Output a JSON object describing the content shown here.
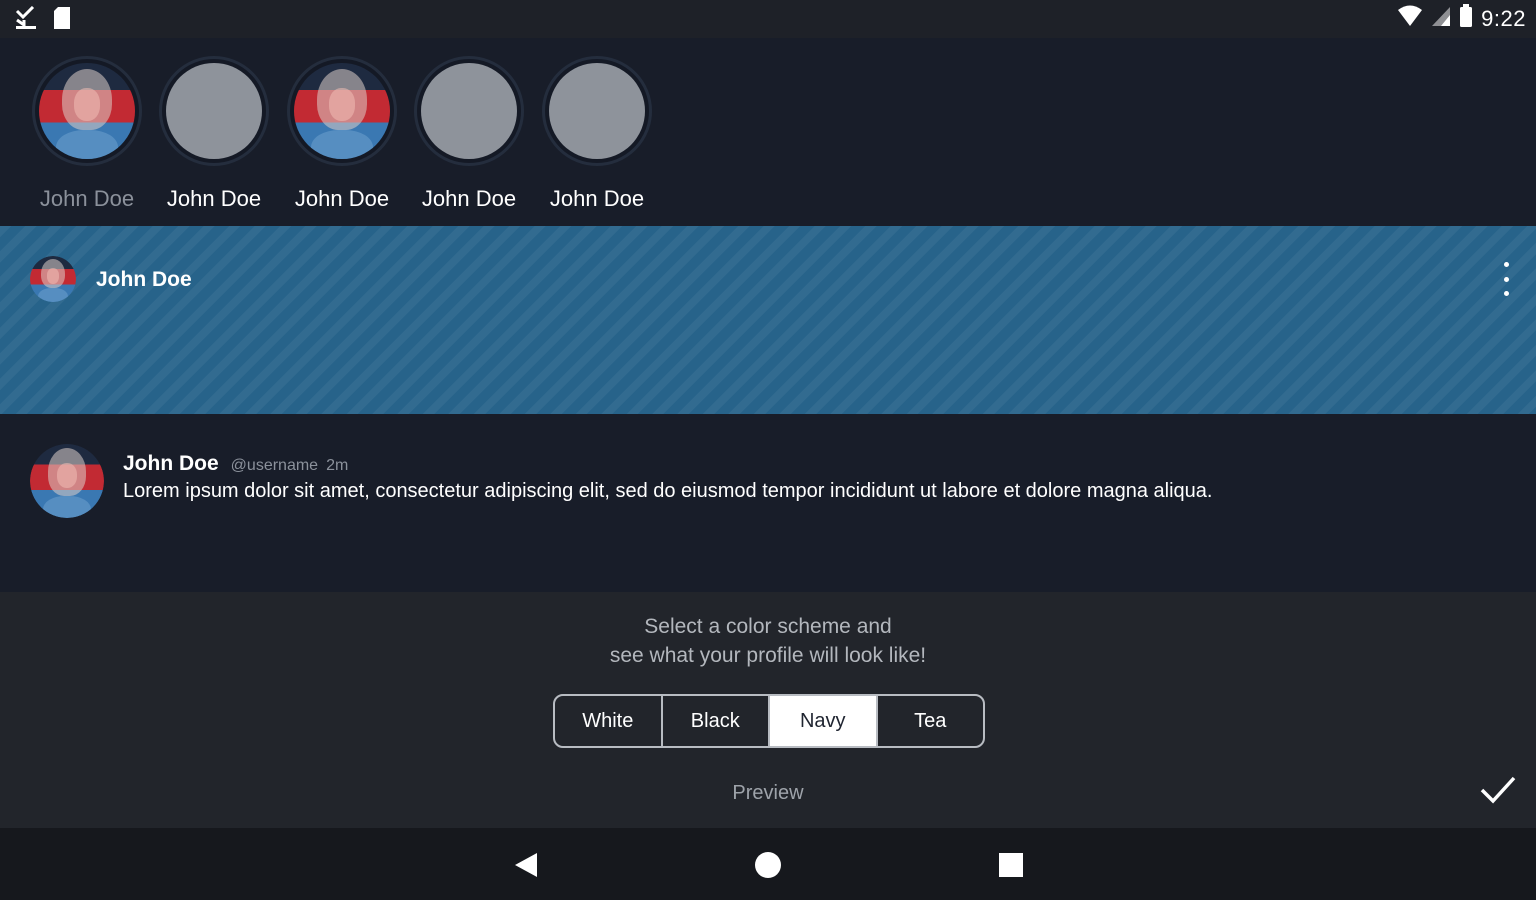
{
  "status_bar": {
    "time": "9:22",
    "icons": [
      "download-done-icon",
      "sd-card-icon",
      "wifi-icon",
      "signal-icon",
      "battery-icon"
    ]
  },
  "stories": [
    {
      "name": "John Doe",
      "has_photo": true,
      "faded": true
    },
    {
      "name": "John Doe",
      "has_photo": false,
      "faded": false
    },
    {
      "name": "John Doe",
      "has_photo": true,
      "faded": false
    },
    {
      "name": "John Doe",
      "has_photo": false,
      "faded": false
    },
    {
      "name": "John Doe",
      "has_photo": false,
      "faded": false
    }
  ],
  "profile_header": {
    "name": "John Doe",
    "menu_icon": "more-vertical-icon"
  },
  "post": {
    "author": "John Doe",
    "handle": "@username",
    "time": "2m",
    "body": "Lorem ipsum dolor sit amet, consectetur adipiscing elit, sed do eiusmod tempor incididunt ut labore et dolore magna aliqua."
  },
  "theme_picker": {
    "hint_line1": "Select a color scheme and",
    "hint_line2": "see what your profile will look like!",
    "options": [
      "White",
      "Black",
      "Navy",
      "Tea"
    ],
    "selected": "Navy",
    "preview_label": "Preview",
    "confirm_icon": "check-icon"
  },
  "nav_bar": {
    "icons": [
      "back-icon",
      "home-icon",
      "recents-icon"
    ]
  },
  "colors": {
    "background": "#181d29",
    "header_accent": "#27638a",
    "panel": "#22252b"
  }
}
